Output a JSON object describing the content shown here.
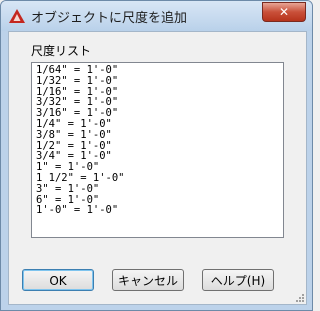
{
  "window": {
    "title": "オブジェクトに尺度を追加",
    "close_label": "✕"
  },
  "scale_list": {
    "label": "尺度リスト",
    "items": [
      "1/64\" = 1'-0\"",
      "1/32\" = 1'-0\"",
      "1/16\" = 1'-0\"",
      "3/32\" = 1'-0\"",
      "3/16\" = 1'-0\"",
      "1/4\" = 1'-0\"",
      "3/8\" = 1'-0\"",
      "1/2\" = 1'-0\"",
      "3/4\" = 1'-0\"",
      "1\" = 1'-0\"",
      "1 1/2\" = 1'-0\"",
      "3\" = 1'-0\"",
      "6\" = 1'-0\"",
      "1'-0\" = 1'-0\""
    ]
  },
  "buttons": {
    "ok": "OK",
    "cancel": "キャンセル",
    "help": "ヘルプ(H)"
  },
  "colors": {
    "app_icon": "#c4271f",
    "close_button": "#c9503a"
  },
  "icons": {
    "app": "autocad-a-icon",
    "close": "close-icon",
    "grip": "resize-grip-icon"
  }
}
